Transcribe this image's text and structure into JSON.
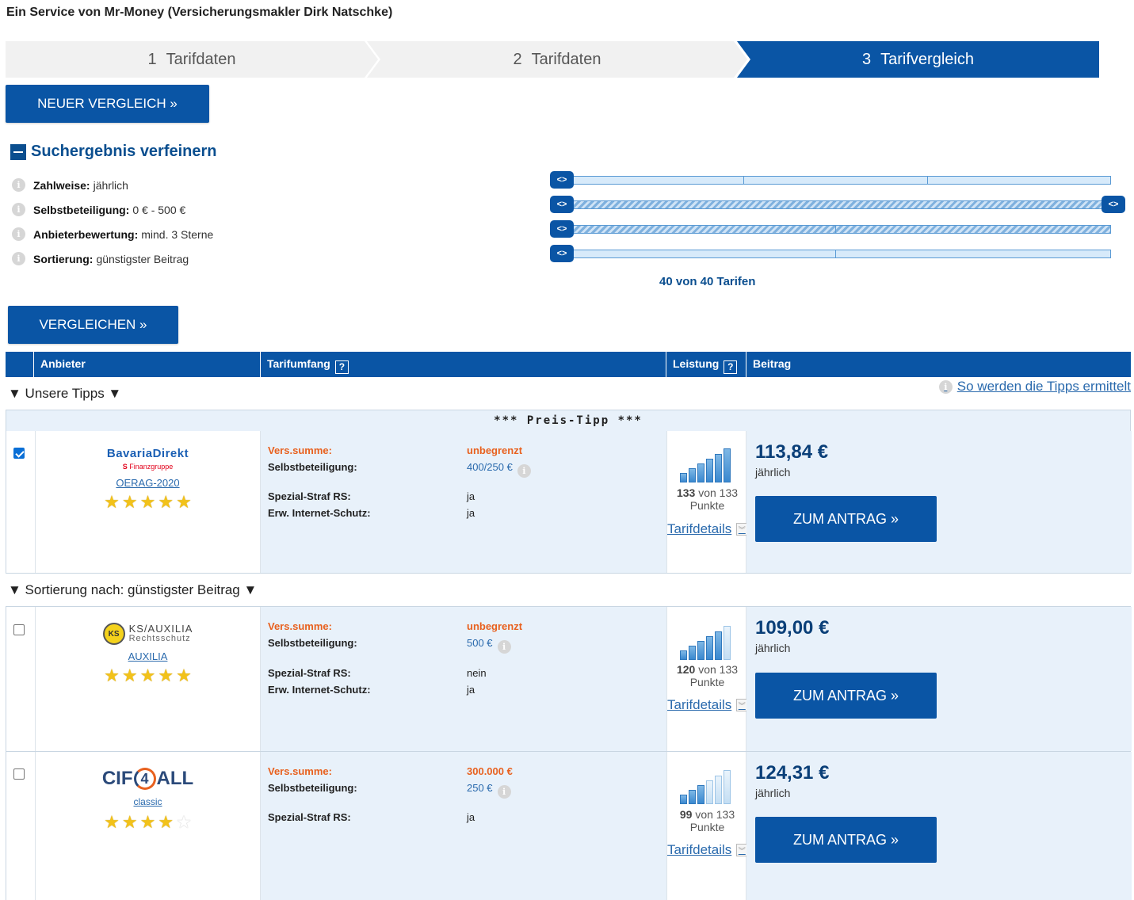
{
  "header": {
    "service_text": "Ein Service von Mr-Money (Versicherungsmakler Dirk Natschke)"
  },
  "steps": [
    {
      "num": "1",
      "label": "Tarifdaten"
    },
    {
      "num": "2",
      "label": "Tarifdaten"
    },
    {
      "num": "3",
      "label": "Tarifvergleich"
    }
  ],
  "buttons": {
    "neuer_vergleich": "NEUER VERGLEICH »",
    "vergleichen": "VERGLEICHEN »"
  },
  "refine": {
    "title": "Suchergebnis verfeinern",
    "filters": [
      {
        "label": "Zahlweise:",
        "value": "jährlich"
      },
      {
        "label": "Selbstbeteiligung:",
        "value": "0 € - 500 €"
      },
      {
        "label": "Anbieterbewertung:",
        "value": "mind. 3 Sterne"
      },
      {
        "label": "Sortierung:",
        "value": "günstigster Beitrag"
      }
    ],
    "handle_glyph": "<>",
    "count_text": "40 von 40 Tarifen"
  },
  "table": {
    "headers": {
      "anbieter": "Anbieter",
      "tarifumfang": "Tarifumfang",
      "leistung": "Leistung",
      "beitrag": "Beitrag",
      "help": "?"
    },
    "group_tipps": "▼ Unsere Tipps ▼",
    "tipps_link": "So werden die Tipps ermittelt",
    "preis_tipp": "*** Preis-Tipp ***",
    "group_sort": "▼ Sortierung nach: günstigster Beitrag ▼"
  },
  "rows": [
    {
      "checked": true,
      "logo_main": "BavariaDirekt",
      "logo_sub": "Finanzgruppe",
      "logo_sub_icon": "S",
      "tariff": "OERAG-2020",
      "rating": 5,
      "vers_summe_label": "Vers.summe:",
      "vers_summe": "unbegrenzt",
      "sb_label": "Selbstbeteiligung:",
      "sb": "400/250 €",
      "extra1_label": "Spezial-Straf RS:",
      "extra1": "ja",
      "extra2_label": "Erw. Internet-Schutz:",
      "extra2": "ja",
      "points": "133",
      "points_text": "von 133",
      "points_unit": "Punkte",
      "tarifdetails": "Tarifdetails",
      "price": "113,84 €",
      "period": "jährlich",
      "cta": "ZUM ANTRAG »"
    },
    {
      "checked": false,
      "logo_main": "KS/AUXILIA",
      "logo_sub": "Rechtsschutz",
      "logo_badge": "KS",
      "tariff": "AUXILIA",
      "rating": 5,
      "vers_summe_label": "Vers.summe:",
      "vers_summe": "unbegrenzt",
      "sb_label": "Selbstbeteiligung:",
      "sb": "500 €",
      "extra1_label": "Spezial-Straf RS:",
      "extra1": "nein",
      "extra2_label": "Erw. Internet-Schutz:",
      "extra2": "ja",
      "points": "120",
      "points_text": "von 133",
      "points_unit": "Punkte",
      "tarifdetails": "Tarifdetails",
      "price": "109,00 €",
      "period": "jährlich",
      "cta": "ZUM ANTRAG »"
    },
    {
      "checked": false,
      "logo_main": "CIF4ALL",
      "logo_part1": "CIF",
      "logo_part2": "4",
      "logo_part3": "ALL",
      "tariff": "classic",
      "rating": 4,
      "vers_summe_label": "Vers.summe:",
      "vers_summe": "300.000 €",
      "sb_label": "Selbstbeteiligung:",
      "sb": "250 €",
      "extra1_label": "Spezial-Straf RS:",
      "extra1": "ja",
      "points": "99",
      "points_text": "von 133",
      "points_unit": "Punkte",
      "tarifdetails": "Tarifdetails",
      "price": "124,31 €",
      "period": "jährlich",
      "cta": "ZUM ANTRAG »"
    }
  ],
  "icons": {
    "info": "i",
    "star": "★",
    "expand": "︾"
  },
  "colors": {
    "primary": "#0a55a5",
    "accent_orange": "#e8611f",
    "row_bg": "#e8f1fa"
  }
}
